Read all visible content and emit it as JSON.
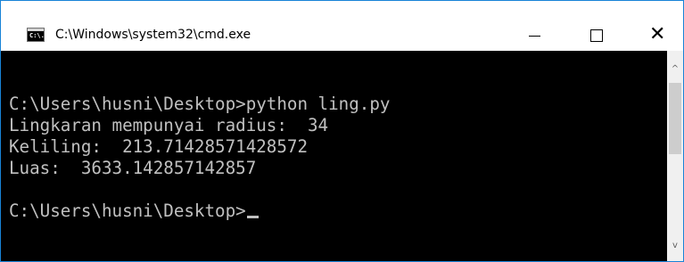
{
  "window": {
    "title": "C:\\Windows\\system32\\cmd.exe",
    "icon": "cmd-icon",
    "icon_glyph": "C:\\.",
    "controls": {
      "minimize_icon": "minimize-icon",
      "maximize_icon": "maximize-icon",
      "close_icon": "close-icon",
      "close_glyph": "✕"
    },
    "accent_color": "#1883d7"
  },
  "console": {
    "lines": [
      "C:\\Users\\husni\\Desktop>python ling.py",
      "Lingkaran mempunyai radius:  34",
      "Keliling:  213.71428571428572",
      "Luas:  3633.142857142857",
      "C:\\Users\\husni\\Desktop>"
    ],
    "background_color": "#000000",
    "text_color": "#c0c0c0"
  },
  "scrollbar": {
    "up_glyph": "^",
    "down_glyph": "v"
  }
}
